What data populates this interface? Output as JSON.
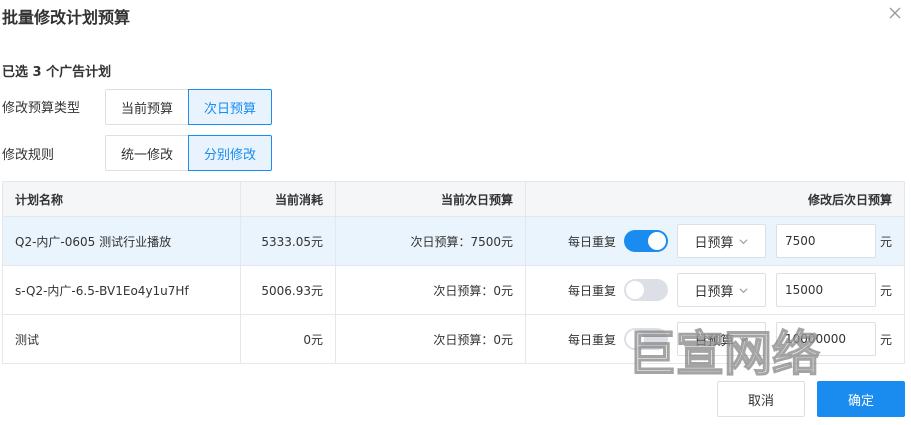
{
  "dialog": {
    "title": "批量修改计划预算"
  },
  "selected_count_text": "已选 3 个广告计划",
  "budget_type": {
    "label": "修改预算类型",
    "options": [
      "当前预算",
      "次日预算"
    ],
    "selected": "次日预算"
  },
  "rule": {
    "label": "修改规则",
    "options": [
      "统一修改",
      "分别修改"
    ],
    "selected": "分别修改"
  },
  "table": {
    "columns": [
      "计划名称",
      "当前消耗",
      "当前次日预算",
      "修改后次日预算"
    ],
    "rows": [
      {
        "name": "Q2-内广-0605 测试行业播放",
        "spend": "5333.05元",
        "next_budget": "次日预算：7500元",
        "repeat_label": "每日重复",
        "repeat_on": true,
        "budget_mode": "日预算",
        "new_budget": "7500",
        "unit": "元"
      },
      {
        "name": "s-Q2-内广-6.5-BV1Eo4y1u7Hf",
        "spend": "5006.93元",
        "next_budget": "次日预算：0元",
        "repeat_label": "每日重复",
        "repeat_on": false,
        "budget_mode": "日预算",
        "new_budget": "15000",
        "unit": "元"
      },
      {
        "name": "测试",
        "spend": "0元",
        "next_budget": "次日预算：0元",
        "repeat_label": "每日重复",
        "repeat_on": false,
        "budget_mode": "日预算",
        "new_budget": "10000000",
        "unit": "元"
      }
    ]
  },
  "footer": {
    "cancel_label": "取消",
    "ok_label": "确定"
  },
  "watermark_text": "巨宣网络",
  "colors": {
    "accent": "#1a8cef",
    "highlight_row": "#eaf4fd",
    "header_bg": "#f5f6f8"
  },
  "icons": {
    "close": "close-icon",
    "dropdown": "chevron-down-icon"
  }
}
